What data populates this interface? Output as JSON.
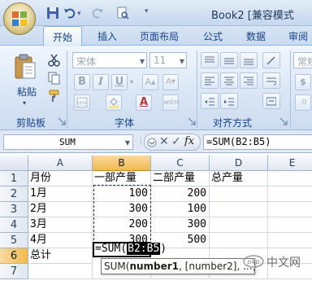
{
  "window": {
    "title": "Book2 [兼容模式"
  },
  "ribbon": {
    "tabs": [
      "开始",
      "插入",
      "页面布局",
      "公式",
      "数据",
      "审阅"
    ],
    "active_tab": "开始",
    "clipboard": {
      "paste_label": "粘贴",
      "group_label": "剪贴板"
    },
    "font": {
      "font_name_placeholder": "宋体",
      "font_size_value": "11",
      "group_label": "字体",
      "bold": "B",
      "italic": "I",
      "underline": "U",
      "format_glyph": "wén"
    },
    "alignment": {
      "group_label": "对齐方式"
    },
    "number": {
      "format_value": "常规"
    }
  },
  "formula_bar": {
    "name_box": "SUM",
    "formula": "=SUM(B2:B5)",
    "fx": "fx",
    "cancel": "✕",
    "enter": "✓"
  },
  "grid": {
    "columns": [
      "A",
      "B",
      "C",
      "D",
      "E"
    ],
    "rows": [
      "1",
      "2",
      "3",
      "4",
      "5",
      "6",
      "7"
    ],
    "active_column": "B",
    "active_row": "6",
    "cells": {
      "A1": "月份",
      "B1": "一部产量",
      "C1": "二部产量",
      "D1": "总产量",
      "A2": "1月",
      "B2": "100",
      "C2": "200",
      "A3": "2月",
      "B3": "300",
      "C3": "100",
      "A4": "3月",
      "B4": "200",
      "C4": "300",
      "A5": "4月",
      "B5": "300",
      "C5": "500",
      "A6": "总计"
    },
    "editing_prefix": "=SUM(",
    "editing_ref": "B2:B5",
    "editing_suffix": ")"
  },
  "tooltip": {
    "func": "SUM(",
    "arg1": "number1",
    "rest": ", [number2], ...)"
  },
  "watermark": "中文网"
}
